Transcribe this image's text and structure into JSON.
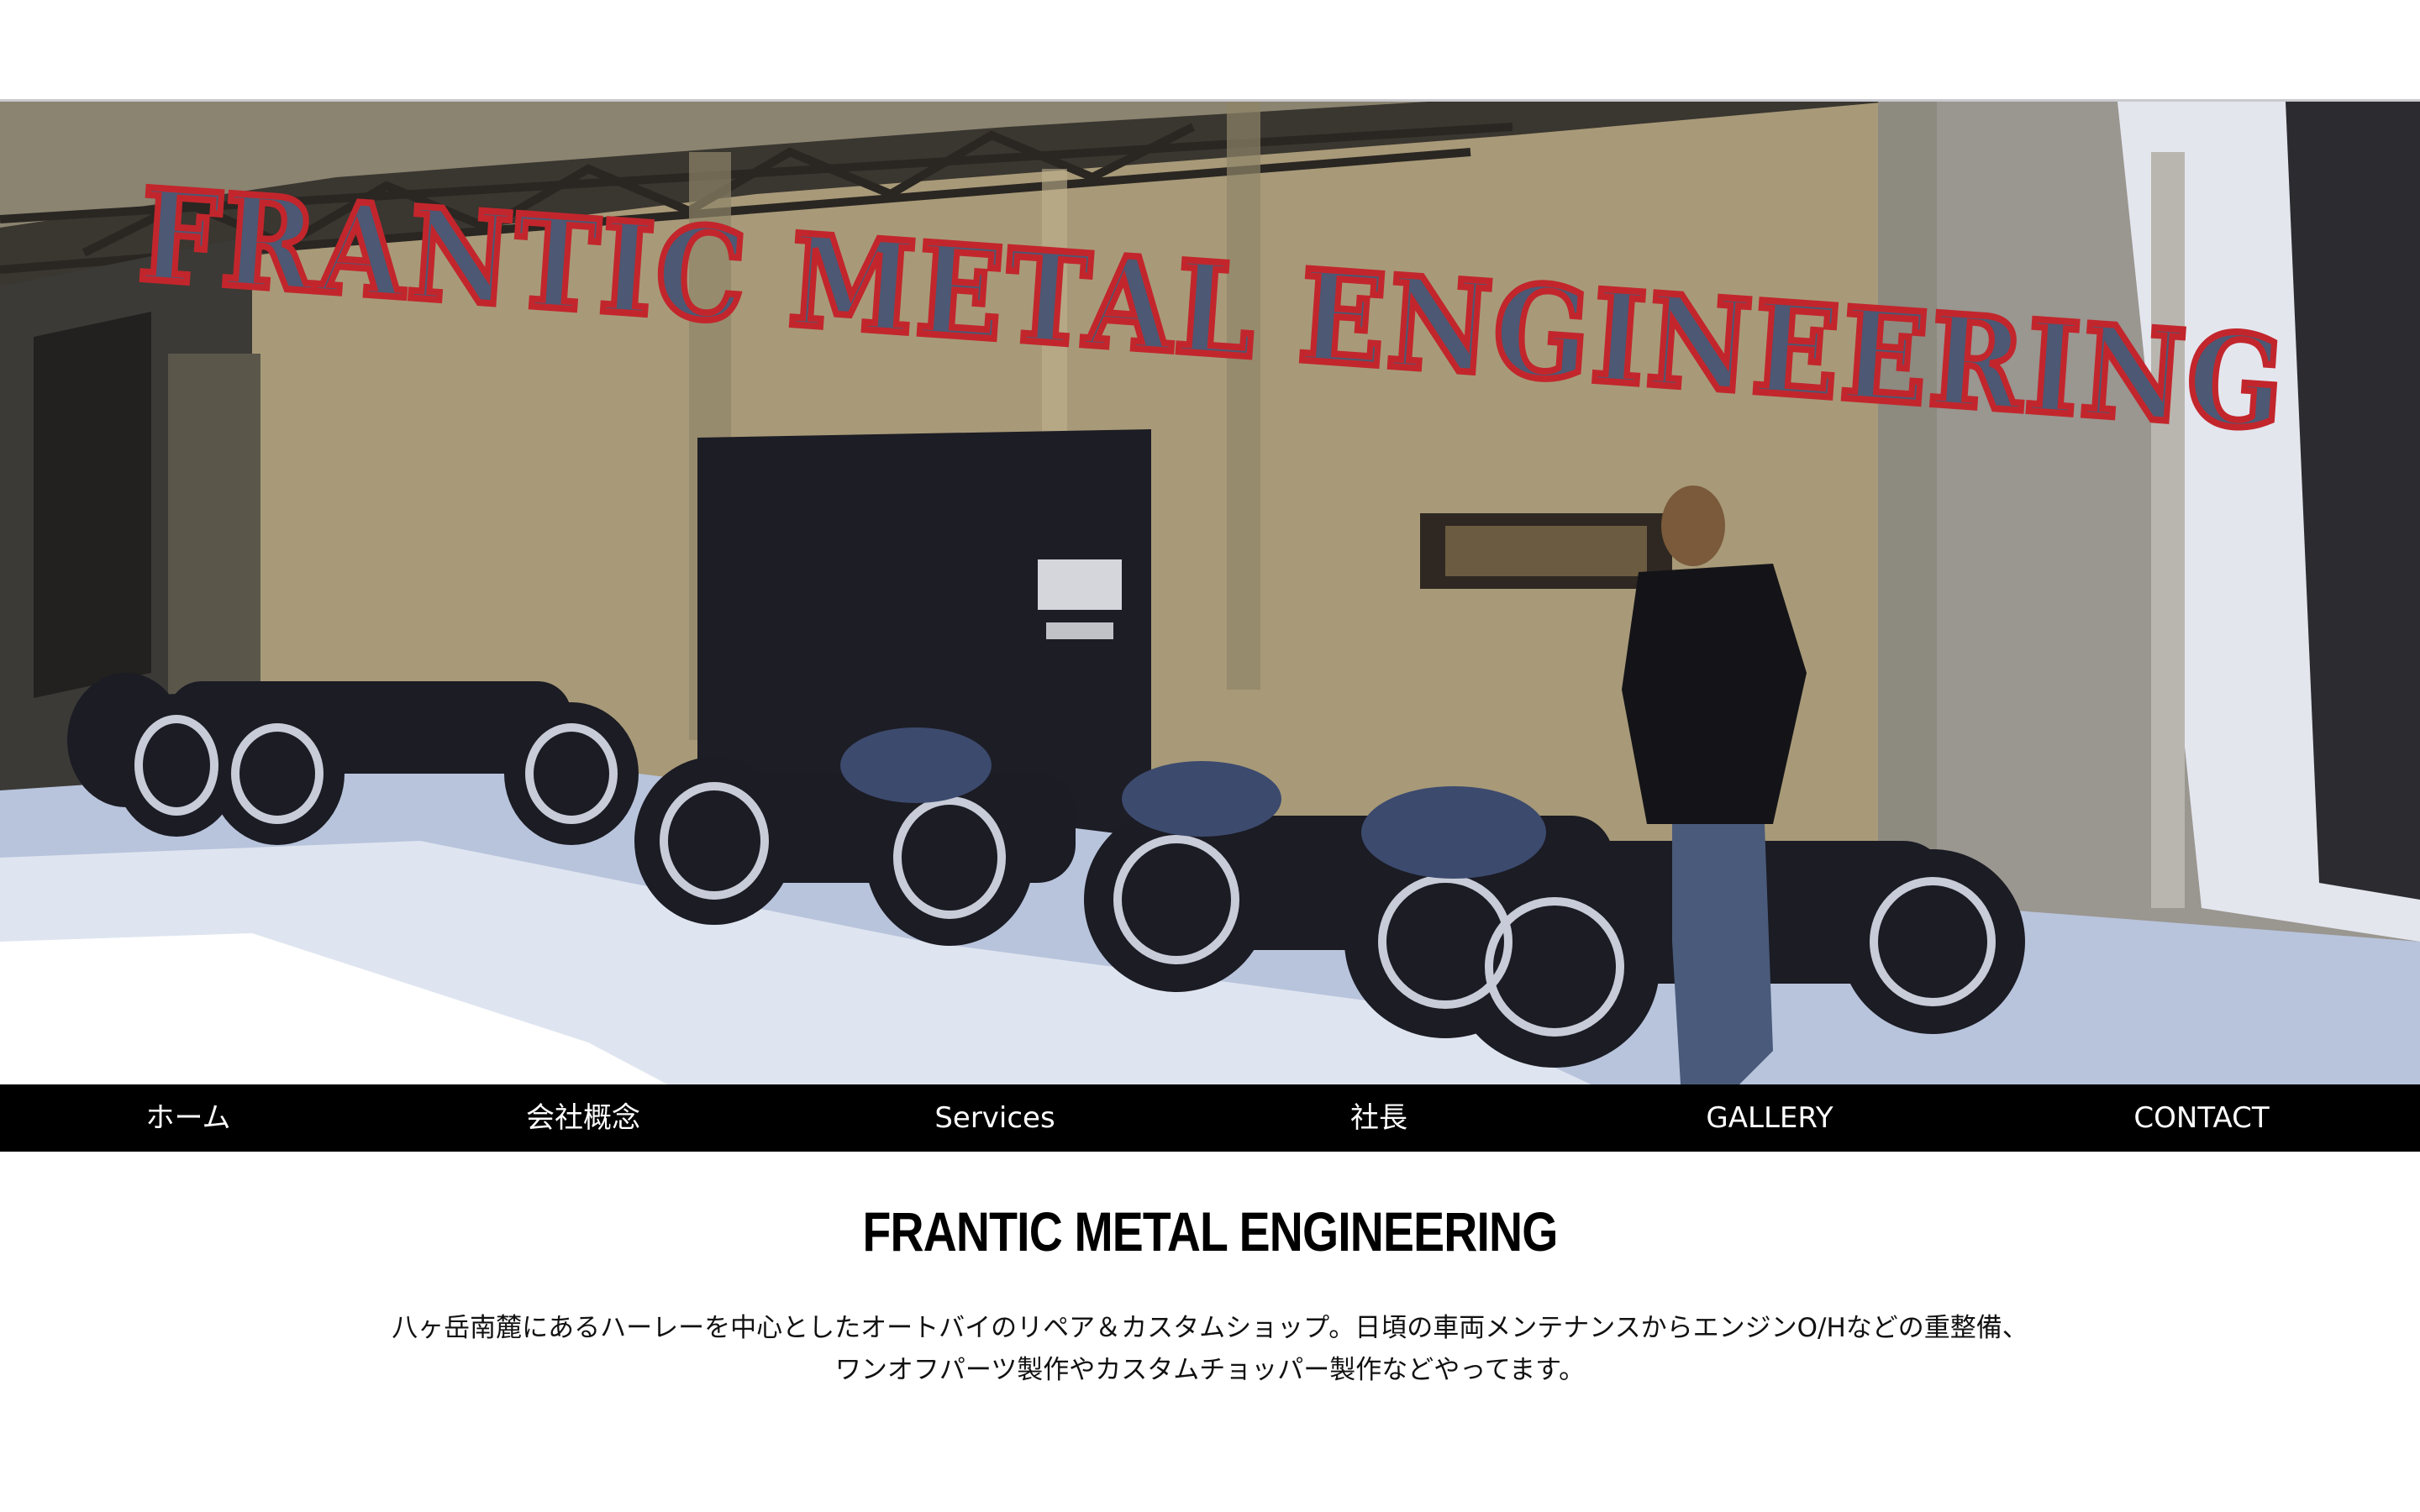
{
  "hero": {
    "sign_text": "FRANTIC METAL ENGINEERING",
    "colors": {
      "wall": "#a89a78",
      "dark": "#1d1d25",
      "ground": "#c9d3e6",
      "sign_fill": "#4c5874",
      "sign_outline": "#c2262c"
    }
  },
  "nav": {
    "items": [
      {
        "label": "ホーム"
      },
      {
        "label": "会社概念"
      },
      {
        "label": "Services"
      },
      {
        "label": "社長"
      },
      {
        "label": "GALLERY"
      },
      {
        "label": "CONTACT"
      }
    ]
  },
  "main": {
    "title": "FRANTIC METAL ENGINEERING",
    "intro_line1": "八ヶ岳南麓にあるハーレーを中心としたオートバイのリペア＆カスタムショップ。日頃の車両メンテナンスからエンジンO/Hなどの重整備、",
    "intro_line2": "ワンオフパーツ製作やカスタムチョッパー製作などやってます。"
  }
}
